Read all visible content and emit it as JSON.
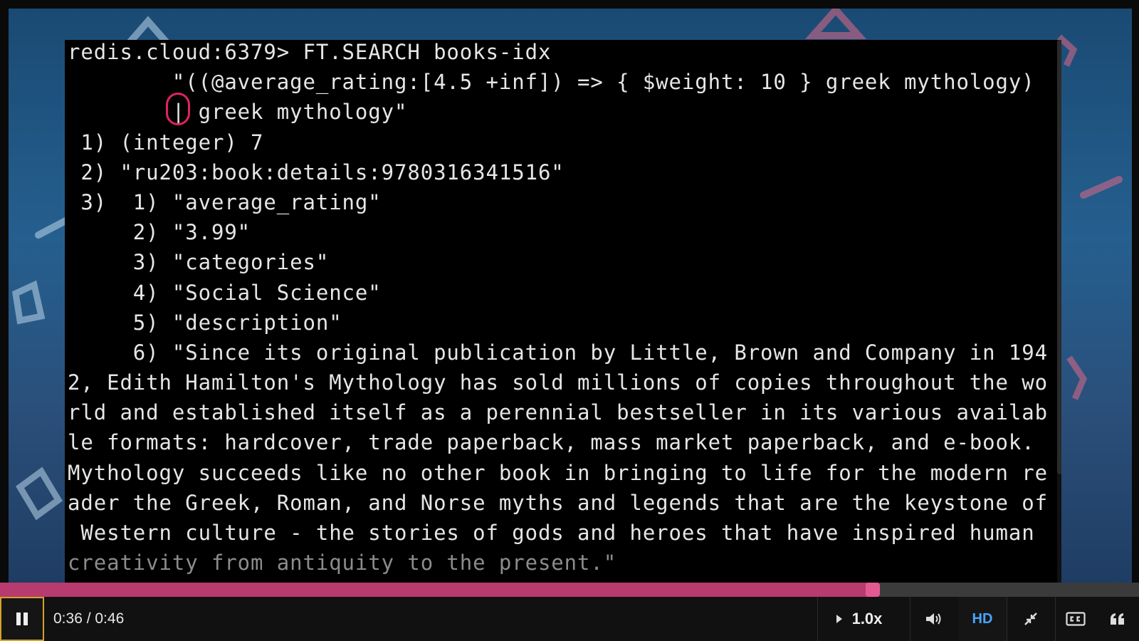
{
  "terminal": {
    "lines": [
      "redis.cloud:6379> FT.SEARCH books-idx",
      "        \"((@average_rating:[4.5 +inf]) => { $weight: 10 } greek mythology)",
      "        | greek mythology\"",
      " 1) (integer) 7",
      " 2) \"ru203:book:details:9780316341516\"",
      " 3)  1) \"average_rating\"",
      "     2) \"3.99\"",
      "     3) \"categories\"",
      "     4) \"Social Science\"",
      "     5) \"description\"",
      "     6) \"Since its original publication by Little, Brown and Company in 194",
      "2, Edith Hamilton's Mythology has sold millions of copies throughout the wo",
      "rld and established itself as a perennial bestseller in its various availab",
      "le formats: hardcover, trade paperback, mass market paperback, and e-book.",
      "Mythology succeeds like no other book in bringing to life for the modern re",
      "ader the Greek, Roman, and Norse myths and legends that are the keystone of",
      " Western culture - the stories of gods and heroes that have inspired human",
      "creativity from antiquity to the present.\""
    ]
  },
  "player": {
    "time_display": "0:36 / 0:46",
    "progress_fraction": 0.766,
    "speed_label": "1.0x",
    "hd_label": "HD",
    "colors": {
      "progress": "#b73b6e",
      "handle": "#e35a93",
      "hd": "#4aa3ff",
      "play_border": "#d7a12b"
    }
  },
  "icons": {
    "play_pause": "pause-icon",
    "speed": "play-triangle-icon",
    "volume": "volume-icon",
    "minimize": "minimize-icon",
    "captions": "cc-icon",
    "transcript": "quote-icon"
  }
}
